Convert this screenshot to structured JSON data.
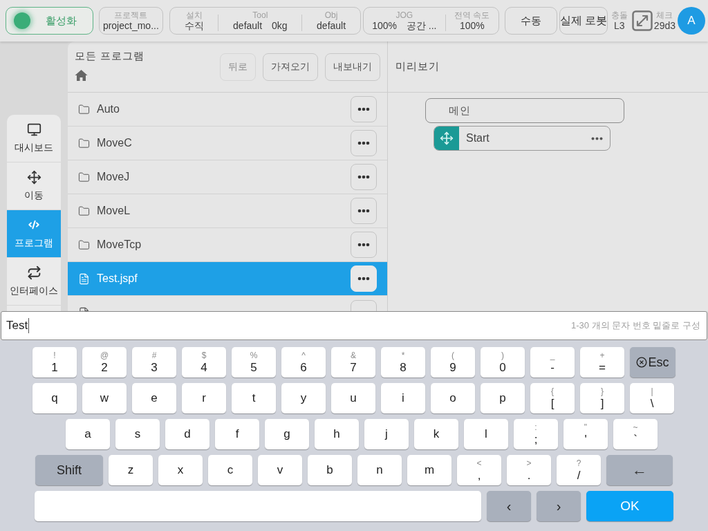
{
  "status_bar": {
    "enable_button": {
      "label": "활성화",
      "on": true
    },
    "project": {
      "label": "프로젝트",
      "value": "project_mo..."
    },
    "setup": [
      {
        "label": "설치",
        "value": "수직"
      },
      {
        "label": "Tool",
        "value": "default",
        "extra": "0kg"
      },
      {
        "label": "Obj",
        "value": "default"
      }
    ],
    "speed": [
      {
        "label": "JOG",
        "value": "100%",
        "extra": "공간 ..."
      },
      {
        "label": "전역 속도",
        "value": "100%"
      }
    ],
    "mode_button": "수동",
    "robot_button": "실제 로봇",
    "collision": {
      "label": "충돌",
      "value": "L3"
    },
    "check": {
      "label": "체크",
      "value": "29d3"
    },
    "avatar": "A"
  },
  "sidebar": {
    "items": [
      {
        "label": "대시보드",
        "selected": false
      },
      {
        "label": "이동",
        "selected": false
      },
      {
        "label": "프로그램",
        "selected": true
      },
      {
        "label": "인터페이스",
        "selected": false
      }
    ]
  },
  "file_panel": {
    "title": "모든 프로그램",
    "buttons": [
      {
        "label": "뒤로",
        "disabled": true
      },
      {
        "label": "가져오기",
        "disabled": false
      },
      {
        "label": "내보내기",
        "disabled": false
      }
    ],
    "rows": [
      {
        "kind": "folder",
        "name": "Auto",
        "selected": false
      },
      {
        "kind": "folder",
        "name": "MoveC",
        "selected": false
      },
      {
        "kind": "folder",
        "name": "MoveJ",
        "selected": false
      },
      {
        "kind": "folder",
        "name": "MoveL",
        "selected": false
      },
      {
        "kind": "folder",
        "name": "MoveTcp",
        "selected": false
      },
      {
        "kind": "file",
        "name": "Test.jspf",
        "selected": true
      },
      {
        "kind": "file",
        "selected": false
      }
    ]
  },
  "preview": {
    "title": "미리보기",
    "main_block": "메인",
    "start_block": "Start"
  },
  "text_input": {
    "value": "Test",
    "hint": "1-30 개의 문자 번호 밑줄로 구성"
  },
  "keyboard": {
    "rows": [
      [
        {
          "kind": "char",
          "label": "1",
          "shift": "!"
        },
        {
          "kind": "char",
          "label": "2",
          "shift": "@"
        },
        {
          "kind": "char",
          "label": "3",
          "shift": "#"
        },
        {
          "kind": "char",
          "label": "4",
          "shift": "$"
        },
        {
          "kind": "char",
          "label": "5",
          "shift": "%"
        },
        {
          "kind": "char",
          "label": "6",
          "shift": "^"
        },
        {
          "kind": "char",
          "label": "7",
          "shift": "&"
        },
        {
          "kind": "char",
          "label": "8",
          "shift": "*"
        },
        {
          "kind": "char",
          "label": "9",
          "shift": "("
        },
        {
          "kind": "char",
          "label": "0",
          "shift": ")"
        },
        {
          "kind": "char",
          "label": "-",
          "shift": "_"
        },
        {
          "kind": "char",
          "label": "=",
          "shift": "+"
        },
        {
          "kind": "esc",
          "label": "Esc"
        }
      ],
      [
        {
          "kind": "char",
          "label": "q"
        },
        {
          "kind": "char",
          "label": "w"
        },
        {
          "kind": "char",
          "label": "e"
        },
        {
          "kind": "char",
          "label": "r"
        },
        {
          "kind": "char",
          "label": "t"
        },
        {
          "kind": "char",
          "label": "y"
        },
        {
          "kind": "char",
          "label": "u"
        },
        {
          "kind": "char",
          "label": "i"
        },
        {
          "kind": "char",
          "label": "o"
        },
        {
          "kind": "char",
          "label": "p"
        },
        {
          "kind": "char",
          "label": "[",
          "shift": "{"
        },
        {
          "kind": "char",
          "label": "]",
          "shift": "}"
        },
        {
          "kind": "char",
          "label": "\\",
          "shift": "|"
        }
      ],
      [
        {
          "kind": "char",
          "label": "a"
        },
        {
          "kind": "char",
          "label": "s"
        },
        {
          "kind": "char",
          "label": "d"
        },
        {
          "kind": "char",
          "label": "f"
        },
        {
          "kind": "char",
          "label": "g"
        },
        {
          "kind": "char",
          "label": "h"
        },
        {
          "kind": "char",
          "label": "j"
        },
        {
          "kind": "char",
          "label": "k"
        },
        {
          "kind": "char",
          "label": "l"
        },
        {
          "kind": "char",
          "label": ";",
          "shift": ":"
        },
        {
          "kind": "char",
          "label": "'",
          "shift": "\""
        },
        {
          "kind": "char",
          "label": "`",
          "shift": "~"
        }
      ],
      [
        {
          "kind": "shift",
          "label": "Shift"
        },
        {
          "kind": "char",
          "label": "z"
        },
        {
          "kind": "char",
          "label": "x"
        },
        {
          "kind": "char",
          "label": "c"
        },
        {
          "kind": "char",
          "label": "v"
        },
        {
          "kind": "char",
          "label": "b"
        },
        {
          "kind": "char",
          "label": "n"
        },
        {
          "kind": "char",
          "label": "m"
        },
        {
          "kind": "char",
          "label": ",",
          "shift": "<"
        },
        {
          "kind": "char",
          "label": ".",
          "shift": ">"
        },
        {
          "kind": "char",
          "label": "/",
          "shift": "?"
        },
        {
          "kind": "backspace",
          "label": "←"
        }
      ],
      [
        {
          "kind": "space"
        },
        {
          "kind": "nav",
          "label": "‹"
        },
        {
          "kind": "nav",
          "label": "›"
        },
        {
          "kind": "ok",
          "label": "OK"
        }
      ]
    ]
  }
}
